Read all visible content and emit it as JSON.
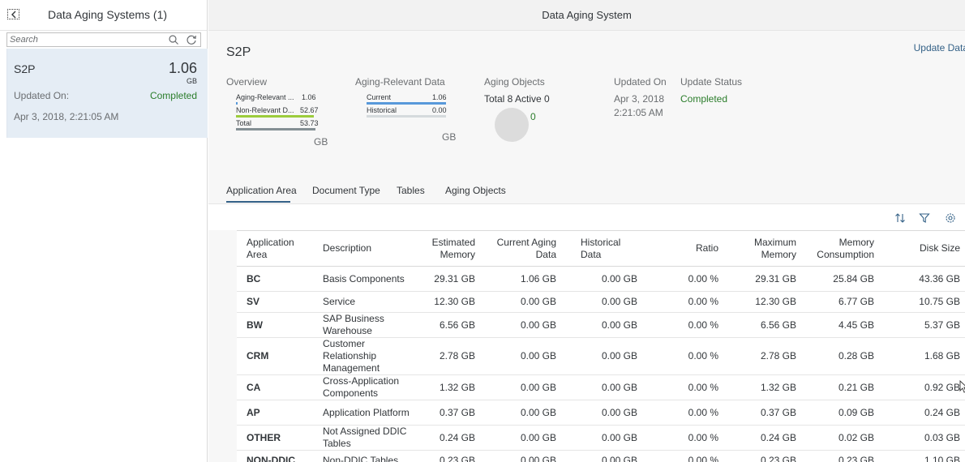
{
  "master": {
    "title": "Data Aging Systems (1)",
    "search_placeholder": "Search",
    "item": {
      "title": "S2P",
      "number": "1.06",
      "unit": "GB",
      "updated_label": "Updated On:",
      "status": "Completed",
      "date": "Apr 3, 2018, 2:21:05 AM"
    }
  },
  "detail": {
    "header_title": "Data Aging System",
    "object_title": "S2P",
    "update_data_label": "Update Data",
    "overview": {
      "label": "Overview",
      "rows": [
        {
          "label": "Aging-Relevant ...",
          "value": "1.06",
          "color": "#5899da",
          "fraction": 0.02
        },
        {
          "label": "Non-Relevant D...",
          "value": "52.67",
          "color": "#9ccc3c",
          "fraction": 0.98
        },
        {
          "label": "Total",
          "value": "53.73",
          "color": "#848f94",
          "fraction": 1.0
        }
      ],
      "unit": "GB"
    },
    "aging_relevant": {
      "label": "Aging-Relevant Data",
      "rows": [
        {
          "label": "Current",
          "value": "1.06",
          "color": "#5899da",
          "fraction": 1.0
        },
        {
          "label": "Historical",
          "value": "0.00",
          "color": "#d5dadd",
          "fraction": 0.0
        }
      ],
      "unit": "GB"
    },
    "aging_objects": {
      "label": "Aging Objects",
      "summary": "Total 8 Active 0",
      "donut_value": "0"
    },
    "updated_on": {
      "label": "Updated On",
      "date": "Apr 3, 2018",
      "time": "2:21:05 AM"
    },
    "update_status": {
      "label": "Update Status",
      "value": "Completed"
    },
    "tabs": [
      {
        "label": "Application Area",
        "selected": true
      },
      {
        "label": "Document Type",
        "selected": false
      },
      {
        "label": "Tables",
        "selected": false
      },
      {
        "label": "Aging Objects",
        "selected": false
      }
    ],
    "toolbar": {
      "sort_icon": "sort-icon",
      "filter_icon": "filter-icon",
      "settings_icon": "settings-icon"
    },
    "table": {
      "headers": [
        "Application Area",
        "Description",
        "Estimated Memory",
        "Current Aging Data",
        "Historical Data",
        "Ratio",
        "Maximum Memory",
        "Memory Consumption",
        "Disk Size"
      ],
      "rows": [
        [
          "BC",
          "Basis Components",
          "29.31 GB",
          "1.06 GB",
          "0.00 GB",
          "0.00 %",
          "29.31 GB",
          "25.84 GB",
          "43.36 GB"
        ],
        [
          "SV",
          "Service",
          "12.30 GB",
          "0.00 GB",
          "0.00 GB",
          "0.00 %",
          "12.30 GB",
          "6.77 GB",
          "10.75 GB"
        ],
        [
          "BW",
          "SAP Business Warehouse",
          "6.56 GB",
          "0.00 GB",
          "0.00 GB",
          "0.00 %",
          "6.56 GB",
          "4.45 GB",
          "5.37 GB"
        ],
        [
          "CRM",
          "Customer Relationship Management",
          "2.78 GB",
          "0.00 GB",
          "0.00 GB",
          "0.00 %",
          "2.78 GB",
          "0.28 GB",
          "1.68 GB"
        ],
        [
          "CA",
          "Cross-Application Components",
          "1.32 GB",
          "0.00 GB",
          "0.00 GB",
          "0.00 %",
          "1.32 GB",
          "0.21 GB",
          "0.92 GB"
        ],
        [
          "AP",
          "Application Platform",
          "0.37 GB",
          "0.00 GB",
          "0.00 GB",
          "0.00 %",
          "0.37 GB",
          "0.09 GB",
          "0.24 GB"
        ],
        [
          "OTHER",
          "Not Assigned DDIC Tables",
          "0.24 GB",
          "0.00 GB",
          "0.00 GB",
          "0.00 %",
          "0.24 GB",
          "0.02 GB",
          "0.03 GB"
        ],
        [
          "NON-DDIC",
          "Non-DDIC Tables",
          "0.23 GB",
          "0.00 GB",
          "0.00 GB",
          "0.00 %",
          "0.23 GB",
          "0.23 GB",
          "1.10 GB"
        ]
      ]
    }
  },
  "colors": {
    "accent": "#346187",
    "positive": "#2b7d2b",
    "selected_item_bg": "#e5edf5"
  }
}
